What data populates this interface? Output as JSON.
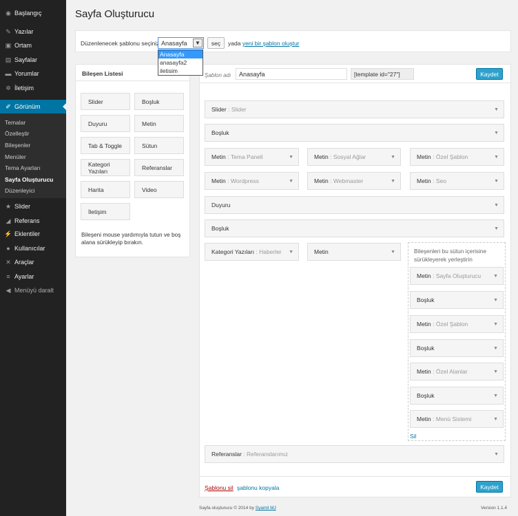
{
  "sidebar": {
    "items": [
      {
        "label": "Başlangıç",
        "icon": "dashboard-icon"
      },
      {
        "label": "Yazılar",
        "icon": "pin-icon"
      },
      {
        "label": "Ortam",
        "icon": "media-icon"
      },
      {
        "label": "Sayfalar",
        "icon": "pages-icon"
      },
      {
        "label": "Yorumlar",
        "icon": "comments-icon"
      },
      {
        "label": "İletişim",
        "icon": "gear-icon"
      },
      {
        "label": "Görünüm",
        "icon": "brush-icon"
      }
    ],
    "submenu": [
      "Temalar",
      "Özelleştir",
      "Bileşenler",
      "Menüler",
      "Tema Ayarları",
      "Sayfa Oluşturucu",
      "Düzenleyici"
    ],
    "items_bottom": [
      {
        "label": "Slider",
        "icon": "star-icon"
      },
      {
        "label": "Referans",
        "icon": "megaphone-icon"
      },
      {
        "label": "Eklentiler",
        "icon": "plugin-icon"
      },
      {
        "label": "Kullanıcılar",
        "icon": "users-icon"
      },
      {
        "label": "Araçlar",
        "icon": "wrench-icon"
      },
      {
        "label": "Ayarlar",
        "icon": "settings-icon"
      },
      {
        "label": "Menüyü daralt",
        "icon": "collapse-icon"
      }
    ]
  },
  "page": {
    "title": "Sayfa Oluşturucu"
  },
  "selector": {
    "label": "Düzenlenecek şablonu seçiniz:",
    "selected": "Anasayfa",
    "options": [
      "Anasayfa",
      "anasayfa2",
      "iletisim"
    ],
    "button": "seç",
    "or_text": "yada",
    "new_link": "yeni bir şablon oluştur"
  },
  "components": {
    "title": "Bileşen Listesi",
    "buttons": [
      "Slider",
      "Boşluk",
      "Duyuru",
      "Metin",
      "Tab & Toggle",
      "Sütun",
      "Kategori Yazıları",
      "Referanslar",
      "Harita",
      "Video",
      "İletişim"
    ],
    "help": "Bileşeni mouse yardımıyla tutun ve boş alana sürükleyip bırakın."
  },
  "builder": {
    "name_label": "Şablon adı",
    "name_value": "Anasayfa",
    "shortcode": "[template id=\"27\"]",
    "save": "Kaydet",
    "rows": [
      {
        "main": "Slider",
        "sub": "Slider"
      },
      {
        "main": "Boşluk",
        "sub": ""
      },
      {
        "main": "Metin",
        "sub": "Tema Paneli"
      },
      {
        "main": "Metin",
        "sub": "Sosyal Ağlar"
      },
      {
        "main": "Metin",
        "sub": "Özel Şablon"
      },
      {
        "main": "Metin",
        "sub": "Wordpress"
      },
      {
        "main": "Metin",
        "sub": "Webmaster"
      },
      {
        "main": "Metin",
        "sub": "Seo"
      },
      {
        "main": "Duyuru",
        "sub": ""
      },
      {
        "main": "Boşluk",
        "sub": ""
      },
      {
        "main": "Kategori Yazıları",
        "sub": "Haberler"
      },
      {
        "main": "Metin",
        "sub": ""
      },
      {
        "main": "Referanslar",
        "sub": "Referanslarımız"
      }
    ],
    "dropzone_hint": "Bileşenleri bu sütun içerisine sürükleyerek yerleştirin",
    "column_items": [
      {
        "main": "Metin",
        "sub": "Sayfa Oluşturucu"
      },
      {
        "main": "Boşluk",
        "sub": ""
      },
      {
        "main": "Metin",
        "sub": "Özel Şablon"
      },
      {
        "main": "Boşluk",
        "sub": ""
      },
      {
        "main": "Metin",
        "sub": "Özel Alanlar"
      },
      {
        "main": "Boşluk",
        "sub": ""
      },
      {
        "main": "Metin",
        "sub": "Menü Sistemi"
      }
    ],
    "column_delete": "Sil",
    "delete_template": "Şablonu sil",
    "copy_template": "şablonu kopyala"
  },
  "footer": {
    "text": "Sayfa oluşturucu © 2014 by",
    "author": "Syamil MJ",
    "version": "Version 1.1.4"
  }
}
